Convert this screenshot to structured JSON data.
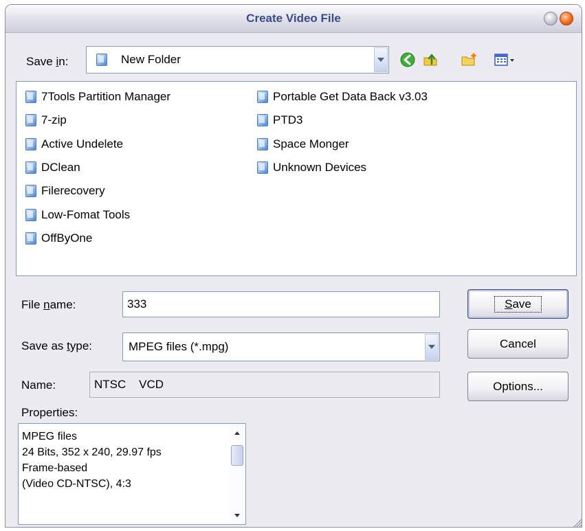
{
  "window": {
    "title": "Create Video File"
  },
  "save_in": {
    "label_pre": "Save ",
    "label_key": "i",
    "label_post": "n:",
    "value": "New Folder"
  },
  "files": {
    "col1": [
      "7Tools Partition Manager",
      "7-zip",
      "Active Undelete",
      "DClean",
      "Filerecovery",
      "Low-Fomat Tools",
      "OffByOne"
    ],
    "col2": [
      "Portable Get Data Back v3.03",
      "PTD3",
      "Space Monger",
      "Unknown Devices"
    ]
  },
  "file_name": {
    "label_pre": "File ",
    "label_key": "n",
    "label_post": "ame:",
    "value": "333"
  },
  "save_type": {
    "label_pre": "Save as ",
    "label_key": "t",
    "label_post": "ype:",
    "value": "MPEG files (*.mpg)"
  },
  "name": {
    "label": "Name:",
    "value": "NTSC    VCD"
  },
  "properties": {
    "label": "Properties:",
    "lines": [
      "MPEG files",
      "24 Bits, 352 x 240, 29.97 fps",
      "Frame-based",
      "(Video CD-NTSC),  4:3"
    ]
  },
  "buttons": {
    "save_key": "S",
    "save_rest": "ave",
    "cancel": "Cancel",
    "options": "Options..."
  },
  "icons": {
    "back": "back-arrow-icon",
    "up": "up-folder-icon",
    "new_folder": "new-folder-icon",
    "views": "views-menu-icon",
    "folder": "folder-icon"
  }
}
